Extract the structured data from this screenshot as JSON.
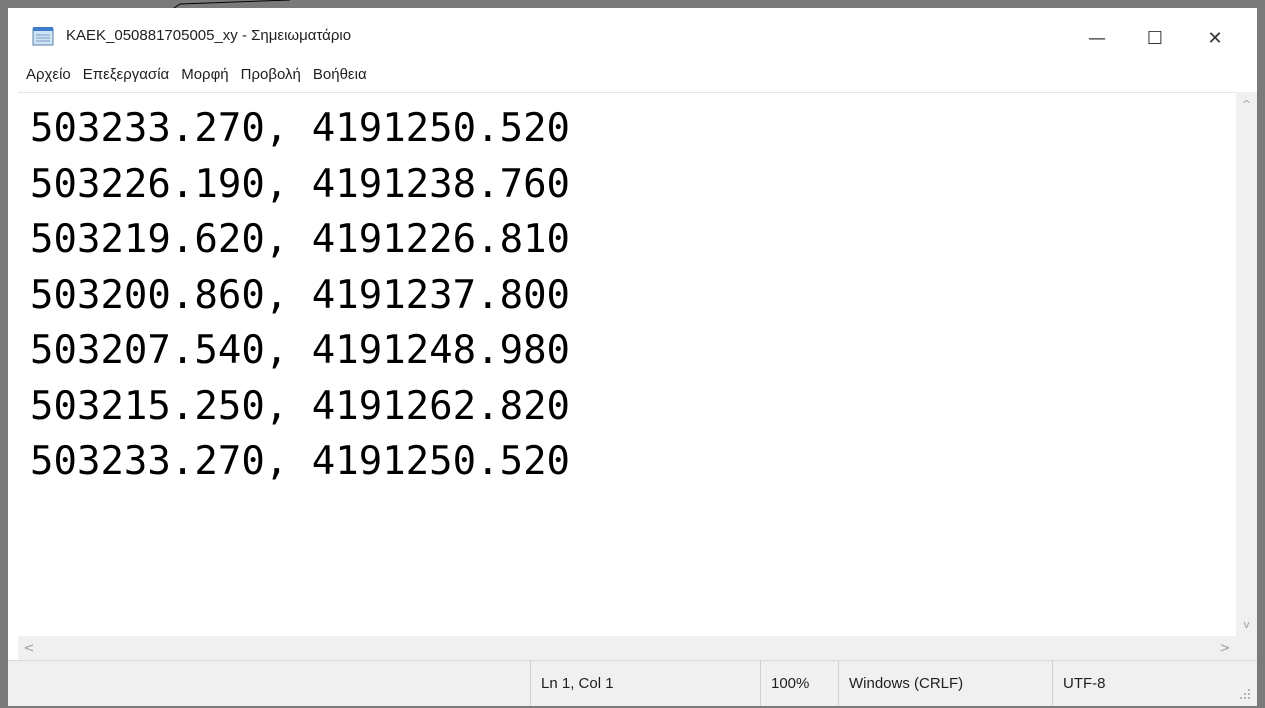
{
  "window": {
    "title": "KAEK_050881705005_xy - Σημειωματάριο",
    "controls": {
      "minimize": "—",
      "maximize": "☐",
      "close": "✕"
    }
  },
  "menu": {
    "items": [
      "Αρχείο",
      "Επεξεργασία",
      "Μορφή",
      "Προβολή",
      "Βοήθεια"
    ]
  },
  "editor": {
    "lines": [
      "503233.270, 4191250.520",
      "503226.190, 4191238.760",
      "503219.620, 4191226.810",
      "503200.860, 4191237.800",
      "503207.540, 4191248.980",
      "503215.250, 4191262.820",
      "503233.270, 4191250.520"
    ]
  },
  "scrollbars": {
    "up": "^",
    "down": "v",
    "left": "<",
    "right": ">"
  },
  "status": {
    "position": "Ln 1, Col 1",
    "zoom": "100%",
    "line_endings": "Windows (CRLF)",
    "encoding": "UTF-8"
  },
  "colors": {
    "frame": "#7a7a7a",
    "chrome": "#f0f0f0",
    "text": "#000000"
  },
  "icons": {
    "app": "notepad-icon",
    "grip": "resize-grip-icon"
  }
}
